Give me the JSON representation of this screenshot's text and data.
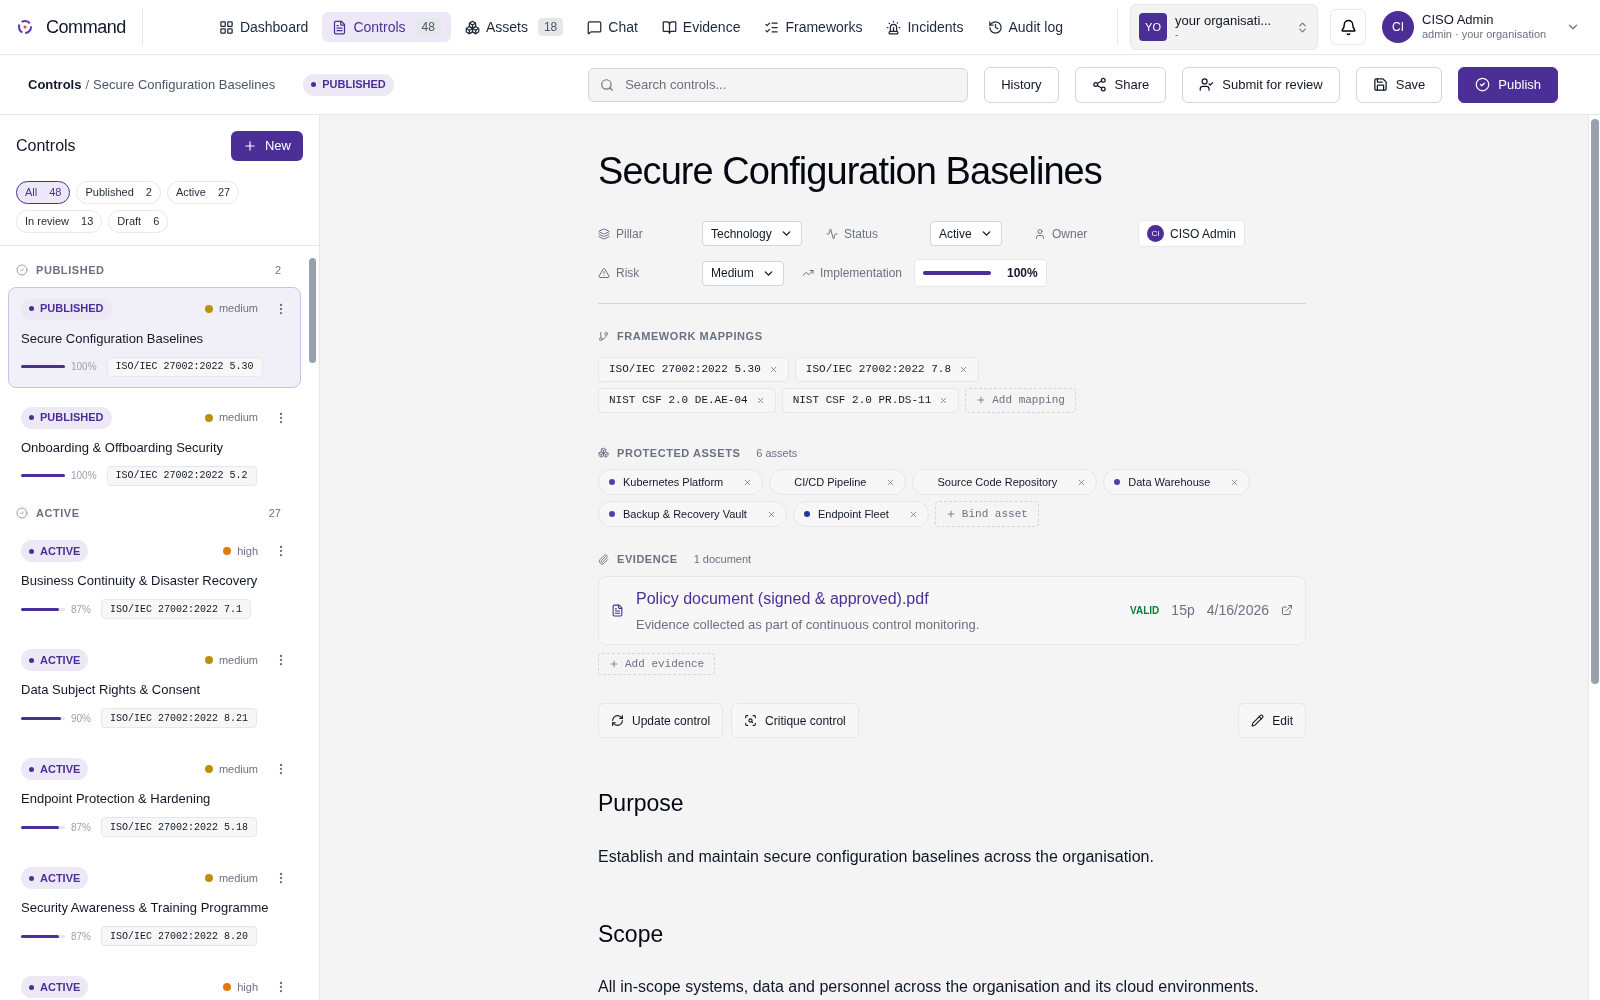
{
  "brand": {
    "name": "Command"
  },
  "nav": [
    {
      "label": "Dashboard",
      "selected": false
    },
    {
      "label": "Controls",
      "count": "48",
      "selected": true
    },
    {
      "label": "Assets",
      "count": "18",
      "selected": false
    },
    {
      "label": "Chat",
      "selected": false
    },
    {
      "label": "Evidence",
      "selected": false
    },
    {
      "label": "Frameworks",
      "selected": false
    },
    {
      "label": "Incidents",
      "selected": false
    },
    {
      "label": "Audit log",
      "selected": false
    }
  ],
  "org": {
    "initials": "YO",
    "name": "your organisati...",
    "sub": "-"
  },
  "user": {
    "initials": "CI",
    "name": "CISO Admin",
    "sub": "admin · your organisation"
  },
  "breadcrumb": {
    "parent": "Controls",
    "separator": "/",
    "current": "Secure Configuration Baselines",
    "status": "PUBLISHED"
  },
  "search": {
    "placeholder": "Search controls..."
  },
  "actions": [
    {
      "label": "History",
      "kind": "plain"
    },
    {
      "label": "Share",
      "kind": "plain"
    },
    {
      "label": "Submit for review",
      "kind": "plain"
    },
    {
      "label": "Save",
      "kind": "plain"
    },
    {
      "label": "Publish",
      "kind": "primary"
    }
  ],
  "sidebar": {
    "title": "Controls",
    "new_button": "New",
    "filters": [
      {
        "label": "All",
        "count": "48",
        "selected": true
      },
      {
        "label": "Published",
        "count": "2",
        "selected": false
      },
      {
        "label": "Active",
        "count": "27",
        "selected": false
      },
      {
        "label": "In review",
        "count": "13",
        "selected": false
      },
      {
        "label": "Draft",
        "count": "6",
        "selected": false
      }
    ],
    "groups": [
      {
        "title": "PUBLISHED",
        "count": "2",
        "items": [
          {
            "status": "PUBLISHED",
            "risk": "medium",
            "color": "#b8920a",
            "title": "Secure Configuration Baselines",
            "level": 1,
            "percent": "100%",
            "mapping": "ISO/IEC 27002:2022 5.30",
            "selected": true
          },
          {
            "status": "PUBLISHED",
            "risk": "medium",
            "color": "#b8920a",
            "title": "Onboarding & Offboarding Security",
            "level": 1,
            "percent": "100%",
            "mapping": "ISO/IEC 27002:2022 5.2",
            "selected": false
          }
        ]
      },
      {
        "title": "ACTIVE",
        "count": "27",
        "items": [
          {
            "status": "ACTIVE",
            "risk": "high",
            "color": "#e07b0a",
            "title": "Business Continuity & Disaster Recovery",
            "level": 0.87,
            "percent": "87%",
            "mapping": "ISO/IEC 27002:2022 7.1",
            "selected": false
          },
          {
            "status": "ACTIVE",
            "risk": "medium",
            "color": "#b8920a",
            "title": "Data Subject Rights & Consent",
            "level": 0.9,
            "percent": "90%",
            "mapping": "ISO/IEC 27002:2022 8.21",
            "selected": false
          },
          {
            "status": "ACTIVE",
            "risk": "medium",
            "color": "#b8920a",
            "title": "Endpoint Protection & Hardening",
            "level": 0.87,
            "percent": "87%",
            "mapping": "ISO/IEC 27002:2022 5.18",
            "selected": false
          },
          {
            "status": "ACTIVE",
            "risk": "medium",
            "color": "#b8920a",
            "title": "Security Awareness & Training Programme",
            "level": 0.87,
            "percent": "87%",
            "mapping": "ISO/IEC 27002:2022 8.20",
            "selected": false
          },
          {
            "status": "ACTIVE",
            "risk": "high",
            "color": "#e07b0a",
            "selected": false
          }
        ]
      }
    ]
  },
  "control": {
    "title": "Secure Configuration Baselines",
    "fields": [
      {
        "label": "Pillar",
        "kind": "select",
        "value": "Technology"
      },
      {
        "label": "Status",
        "kind": "select",
        "value": "Active"
      },
      {
        "label": "Owner",
        "kind": "owner",
        "initials": "CI",
        "value": "CISO Admin"
      },
      {
        "label": "Risk",
        "kind": "select",
        "value": "Medium"
      },
      {
        "label": "Implementation",
        "kind": "progress",
        "level": 1,
        "value": "100%"
      }
    ],
    "mappings": {
      "title": "FRAMEWORK MAPPINGS",
      "items": [
        "ISO/IEC 27002:2022 5.30",
        "ISO/IEC 27002:2022 7.8",
        "NIST CSF 2.0 DE.AE-04",
        "NIST CSF 2.0 PR.DS-11"
      ],
      "add": "Add mapping"
    },
    "assets": {
      "title": "PROTECTED ASSETS",
      "count": "6 assets",
      "items": [
        {
          "name": "Kubernetes Platform",
          "color": "#5b3aa6"
        },
        {
          "name": "CI/CD Pipeline"
        },
        {
          "name": "Source Code Repository"
        },
        {
          "name": "Data Warehouse",
          "color": "#5b3aa6"
        },
        {
          "name": "Backup & Recovery Vault",
          "color": "#5b3aa6"
        },
        {
          "name": "Endpoint Fleet",
          "color": "#1e3a9e"
        }
      ],
      "add": "Bind asset"
    },
    "evidence": {
      "title": "EVIDENCE",
      "count": "1 document",
      "items": [
        {
          "name": "Policy document (signed & approved).pdf",
          "description": "Evidence collected as part of continuous control monitoring.",
          "status": "VALID",
          "pages": "15p",
          "date": "4/16/2026"
        }
      ],
      "add": "Add evidence"
    },
    "buttons": [
      "Update control",
      "Critique control"
    ],
    "edit": "Edit",
    "sections": [
      {
        "heading": "Purpose",
        "body": "Establish and maintain secure configuration baselines across the organisation."
      },
      {
        "heading": "Scope",
        "body": "All in-scope systems, data and personnel across the organisation and its cloud environments."
      }
    ]
  }
}
